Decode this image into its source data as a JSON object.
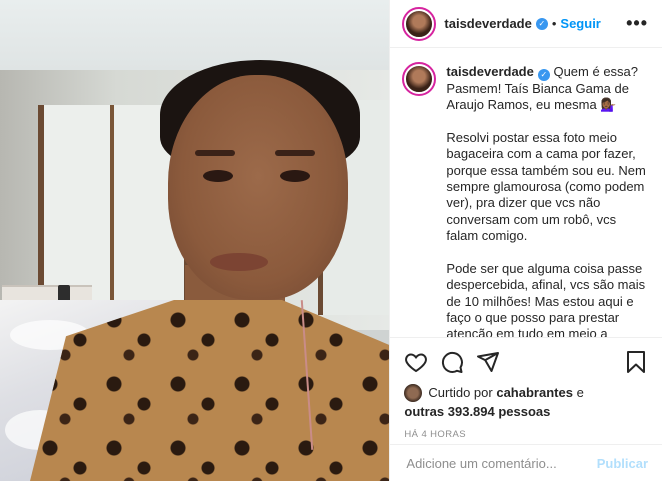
{
  "post": {
    "username": "taisdeverdade",
    "follow_label": "Seguir",
    "separator": "•",
    "more_label": "•••"
  },
  "caption": {
    "username": "taisdeverdade",
    "p1": "Quem é essa? Pasmem! Taís Bianca Gama de Araujo Ramos, eu mesma 💁🏾‍♀️",
    "p2": "Resolvi postar essa foto meio bagaceira com a cama por fazer, porque essa também sou eu. Nem sempre glamourosa (como podem ver), pra dizer que vcs não conversam com um robô, vcs falam comigo.",
    "p3": "Pode ser que alguma coisa passe despercebida, afinal, vcs são mais de 10 milhões! Mas estou aqui e faço o que posso para prestar atenção em tudo em meio a correria de trabalho, maternidade, casa, cuidados diante do isolamento e afins."
  },
  "likes": {
    "prefix": "Curtido por",
    "user": "cahabrantes",
    "conj": "e",
    "others": "outras 393.894 pessoas"
  },
  "timestamp": "HÁ 4 HORAS",
  "comment": {
    "placeholder": "Adicione um comentário...",
    "publish_label": "Publicar"
  },
  "icons": [
    "heart-icon",
    "comment-icon",
    "share-icon",
    "bookmark-icon",
    "verified-icon",
    "more-options-icon"
  ]
}
